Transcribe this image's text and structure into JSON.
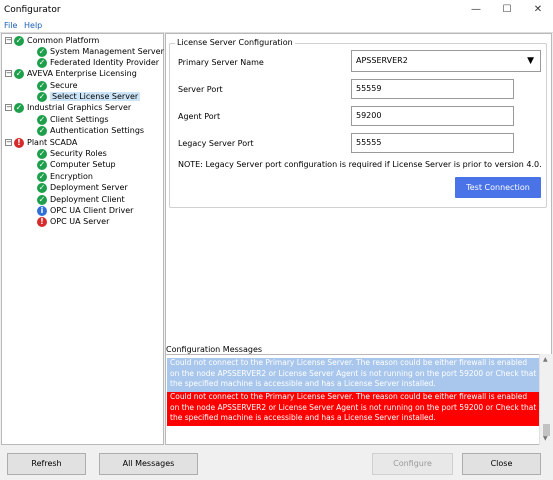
{
  "window": {
    "title": "Configurator"
  },
  "menu": [
    {
      "label": "File"
    },
    {
      "label": "Help"
    }
  ],
  "tree": {
    "nodes": [
      {
        "label": "Common Platform",
        "status": "ok",
        "level": 0
      },
      {
        "label": "System Management Server",
        "status": "ok",
        "level": 1
      },
      {
        "label": "Federated Identity Provider",
        "status": "ok",
        "level": 1
      },
      {
        "label": "AVEVA Enterprise Licensing",
        "status": "ok",
        "level": 0
      },
      {
        "label": "Secure",
        "status": "ok",
        "level": 1
      },
      {
        "label": "Select License Server",
        "status": "ok",
        "level": 1,
        "selected": true
      },
      {
        "label": "Industrial Graphics Server",
        "status": "ok",
        "level": 0
      },
      {
        "label": "Client Settings",
        "status": "ok",
        "level": 1
      },
      {
        "label": "Authentication Settings",
        "status": "ok",
        "level": 1
      },
      {
        "label": "Plant SCADA",
        "status": "error",
        "level": 0
      },
      {
        "label": "Security Roles",
        "status": "ok",
        "level": 1
      },
      {
        "label": "Computer Setup",
        "status": "ok",
        "level": 1
      },
      {
        "label": "Encryption",
        "status": "ok",
        "level": 1
      },
      {
        "label": "Deployment Server",
        "status": "ok",
        "level": 1
      },
      {
        "label": "Deployment Client",
        "status": "ok",
        "level": 1
      },
      {
        "label": "OPC UA Client Driver",
        "status": "info",
        "level": 1
      },
      {
        "label": "OPC UA Server",
        "status": "error",
        "level": 1
      }
    ]
  },
  "license_config": {
    "group_title": "License Server Configuration",
    "primary_server_label": "Primary Server Name",
    "primary_server_value": "APSSERVER2",
    "server_port_label": "Server Port",
    "server_port_value": "55559",
    "agent_port_label": "Agent Port",
    "agent_port_value": "59200",
    "legacy_port_label": "Legacy Server Port",
    "legacy_port_value": "55555",
    "note": "NOTE: Legacy Server port configuration is required if License Server is prior to version 4.0.",
    "test_button": "Test Connection"
  },
  "messages": {
    "title": "Configuration Messages",
    "items": [
      {
        "text": "Could not connect to the Primary License Server.  The reason could be either firewall is enabled on the node APSSERVER2 or License Server Agent is not running on the port 59200 or Check that the specified machine is accessible and has a License Server installed.",
        "color": "#a9c7ec"
      },
      {
        "text": "Could not connect to the Primary License Server.  The reason could be either firewall is enabled on the node APSSERVER2 or License Server Agent is not running on the port 59200 or Check that the specified machine is accessible and has a License Server installed.",
        "color": "#ff0000"
      }
    ]
  },
  "buttons": {
    "refresh": "Refresh",
    "all_messages": "All Messages",
    "configure": "Configure",
    "close": "Close"
  },
  "icons": {
    "status_ok": "check-circle-icon",
    "status_error": "exclamation-circle-icon",
    "status_info": "info-circle-icon"
  },
  "colors": {
    "accent": "#4a73e8",
    "ok": "#1e9f4b",
    "error": "#d52b2b",
    "info": "#2e6fd8"
  }
}
